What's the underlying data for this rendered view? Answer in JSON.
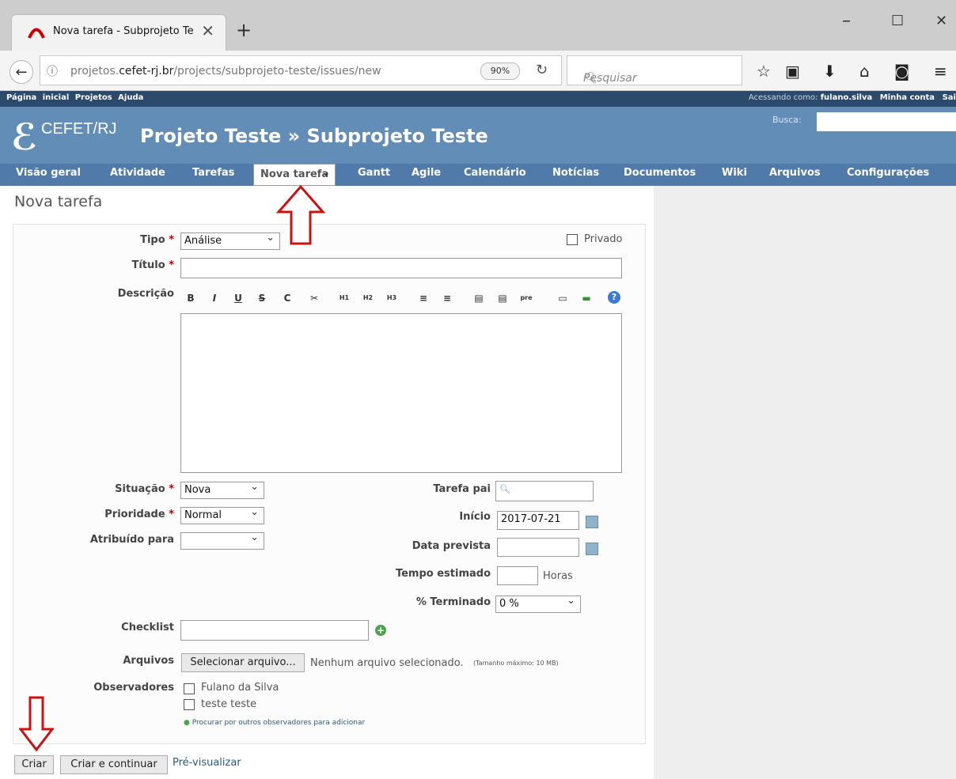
{
  "browser": {
    "tab_title": "Nova tarefa - Subprojeto Te",
    "url_host": "projetos.",
    "url_domain": "cefet-rj.br",
    "url_path": "/projects/subprojeto-teste/issues/new",
    "zoom": "90%",
    "search_placeholder": "Pesquisar"
  },
  "topmenu": {
    "left": "Página inicial  Projetos  Ajuda",
    "right_prefix": "Acessando como: ",
    "user": "fulano.silva",
    "my_account": "Minha conta",
    "logout": "Sai"
  },
  "header": {
    "brand": "CEFET/RJ",
    "project_title": "Projeto Teste » Subprojeto Teste",
    "search_label": "Busca:"
  },
  "main_menu": [
    "Visão geral",
    "Atividade",
    "Tarefas",
    "Nova tarefa",
    "Gantt",
    "Agile",
    "Calendário",
    "Notícias",
    "Documentos",
    "Wiki",
    "Arquivos",
    "Configurações"
  ],
  "page_title": "Nova tarefa",
  "form": {
    "tipo_label": "Tipo",
    "tipo_value": "Análise",
    "privado_label": "Privado",
    "titulo_label": "Título",
    "descricao_label": "Descrição",
    "situacao_label": "Situação",
    "situacao_value": "Nova",
    "prioridade_label": "Prioridade",
    "prioridade_value": "Normal",
    "atribuido_label": "Atribuído para",
    "atribuido_value": "",
    "tarefa_pai_label": "Tarefa pai",
    "inicio_label": "Início",
    "inicio_value": "2017-07-21",
    "data_prevista_label": "Data prevista",
    "tempo_label": "Tempo estimado",
    "horas_label": "Horas",
    "terminado_label": "% Terminado",
    "terminado_value": "0 %",
    "checklist_label": "Checklist",
    "arquivos_label": "Arquivos",
    "select_file_button": "Selecionar arquivo...",
    "no_file_text": "Nenhum arquivo selecionado.",
    "max_size_text": "(Tamanho máximo: 10 MB)",
    "observadores_label": "Observadores",
    "watchers": [
      "Fulano da Silva",
      "teste teste"
    ],
    "search_watchers_link": "Procurar por outros observadores para adicionar"
  },
  "toolbar_buttons": [
    "B",
    "I",
    "U",
    "S",
    "C",
    "✂",
    "H1",
    "H2",
    "H3",
    "≡",
    "≡",
    "▤",
    "▤",
    "pre",
    "▭",
    "▬",
    "?"
  ],
  "buttons": {
    "criar": "Criar",
    "criar_continuar": "Criar e continuar",
    "preview": "Pré-visualizar"
  },
  "colors": {
    "header_bg": "#628db6",
    "topmenu_bg": "#2c4a6c",
    "mainmenu_bg": "#507aaa",
    "arrow": "#cc1111"
  }
}
